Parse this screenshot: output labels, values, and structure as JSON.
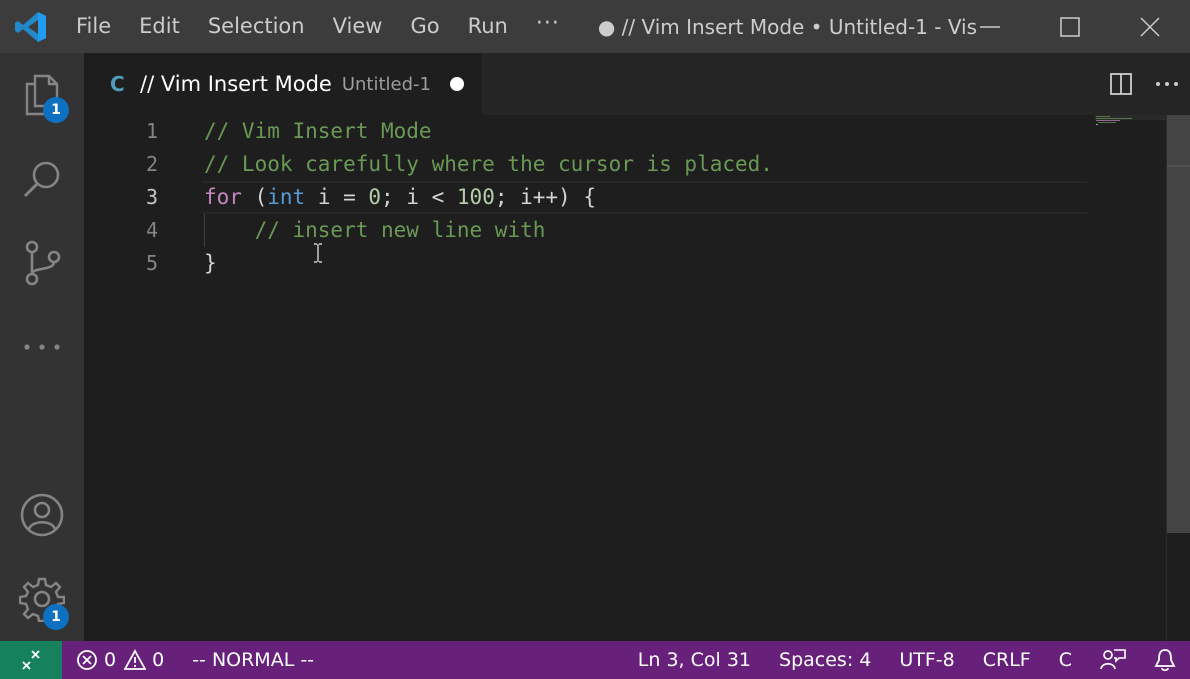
{
  "titlebar": {
    "menu": [
      "File",
      "Edit",
      "Selection",
      "View",
      "Go",
      "Run"
    ],
    "more": "···",
    "window_title": "● // Vim Insert Mode • Untitled-1 - Vis..."
  },
  "activity": {
    "explorer_badge": "1",
    "settings_badge": "1"
  },
  "tab": {
    "lang": "C",
    "title": "// Vim Insert Mode",
    "desc": "Untitled-1"
  },
  "editor": {
    "line_numbers": [
      "1",
      "2",
      "3",
      "4",
      "5"
    ],
    "lines": [
      [
        {
          "t": "// Vim Insert Mode",
          "c": "cmt"
        }
      ],
      [
        {
          "t": "// Look carefully where the cursor is placed.",
          "c": "cmt"
        }
      ],
      [
        {
          "t": "for",
          "c": "kw"
        },
        {
          "t": " (",
          "c": ""
        },
        {
          "t": "int",
          "c": "type"
        },
        {
          "t": " i = ",
          "c": ""
        },
        {
          "t": "0",
          "c": "num"
        },
        {
          "t": "; i < ",
          "c": ""
        },
        {
          "t": "100",
          "c": "num"
        },
        {
          "t": "; i++) {",
          "c": ""
        }
      ],
      [
        {
          "t": "    ",
          "c": ""
        },
        {
          "t": "// insert new line with",
          "c": "cmt"
        }
      ],
      [
        {
          "t": "}",
          "c": ""
        }
      ]
    ],
    "active_line": 3
  },
  "statusbar": {
    "errors": "0",
    "warnings": "0",
    "mode": "-- NORMAL --",
    "position": "Ln 3, Col 31",
    "spaces": "Spaces: 4",
    "encoding": "UTF-8",
    "eol": "CRLF",
    "language": "C"
  },
  "colors": {
    "statusbar": "#68217a",
    "remote": "#16825d",
    "badge": "#0e70c0",
    "comment": "#6a9955",
    "keyword": "#c586c0",
    "type": "#569cd6",
    "number": "#b5cea8"
  }
}
